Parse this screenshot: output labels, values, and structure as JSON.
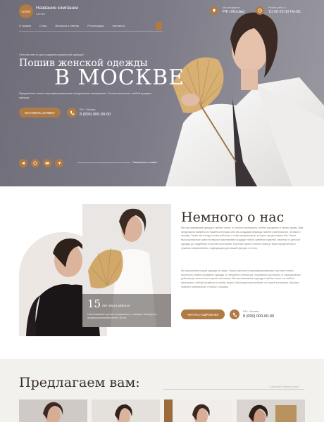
{
  "header": {
    "logo": "LOGO",
    "company_name": "Название компании",
    "company_slogan": "Ателье",
    "city_label": "Мы находимся",
    "city_value": "РФ г.Москва",
    "hours_label": "Режим работы",
    "hours_value": "10.00-22.00 Пн-Вс"
  },
  "nav": {
    "items": [
      "О нашем",
      "О нас",
      "Вопросы и ответы",
      "Регистрация",
      "Контакты"
    ]
  },
  "hero": {
    "pre_title": "Уточное место для создания модельной одежды!",
    "title_line1": "Пошив женской одежды",
    "title_line2": "В МОСКВЕ",
    "description": "Предлагаем только сертифицированные натуральные материалы. Готовы воплотить любой предмет одежды.",
    "cta_label": "ОСТАВИТЬ ЗАЯВКУ",
    "phone_label": "РФ г. Москва",
    "phone_value": "8 (000) 000-00-00",
    "contact_text": "Свяжитесь с нами!",
    "socials": [
      "telegram-icon",
      "whatsapp-icon",
      "youtube-icon",
      "send-icon"
    ]
  },
  "about": {
    "title": "Немного о нас",
    "paragraph1": "Мы изготавливаем одежду в любом стиле, из любого материала, любой расцветки и любых форм. Вам предложить выбрать из нашей коллекции или мы создадим образцы тканей и материалов, готовые к пошиву. Также мы всегда готовы работать с теми материалами, которые предоставите Вы. Наши высококлассные швеи по вашим пожеланиям создадут любое швейное изделие, начиная от детской одежды до свадебных платьев и костюмов. Портные нашего ателье помогут Вам определиться с нужным направлением, подходящим для вашей фигуры и стиля.",
    "paragraph2": "Мы выполняем пошив одежды на заказ. Наши опытные и квалифицированные портные готовы воплотить любые предметы одежды: от вечернего платья до спортивных костюмов, от повседневных рубашек до элегантных строгих костюмов. Мы изготавливаем одежду в любом стиле, из любого материала, любой расцветки и любых форм. Вам предложат выбрать из нашей коллекции образцы тканей и материалов, готовые к пошиву.",
    "cta_label": "ЧИТАТЬ ПОДРОБНЕЕ",
    "phone_label": "РФ г. Москва",
    "phone_value": "8 (000) 000-00-00",
    "years_number": "15",
    "years_title": "Лет опыта работы!",
    "years_desc": "Наш компания лучшие специалисты, знающие своё дело и профессиональные более 15 лет."
  },
  "offers": {
    "title": "Предлагаем вам:",
    "link": "Широкий спектр услуг!"
  },
  "colors": {
    "accent": "#b07a44",
    "hero_bg": "#7c7a86"
  }
}
